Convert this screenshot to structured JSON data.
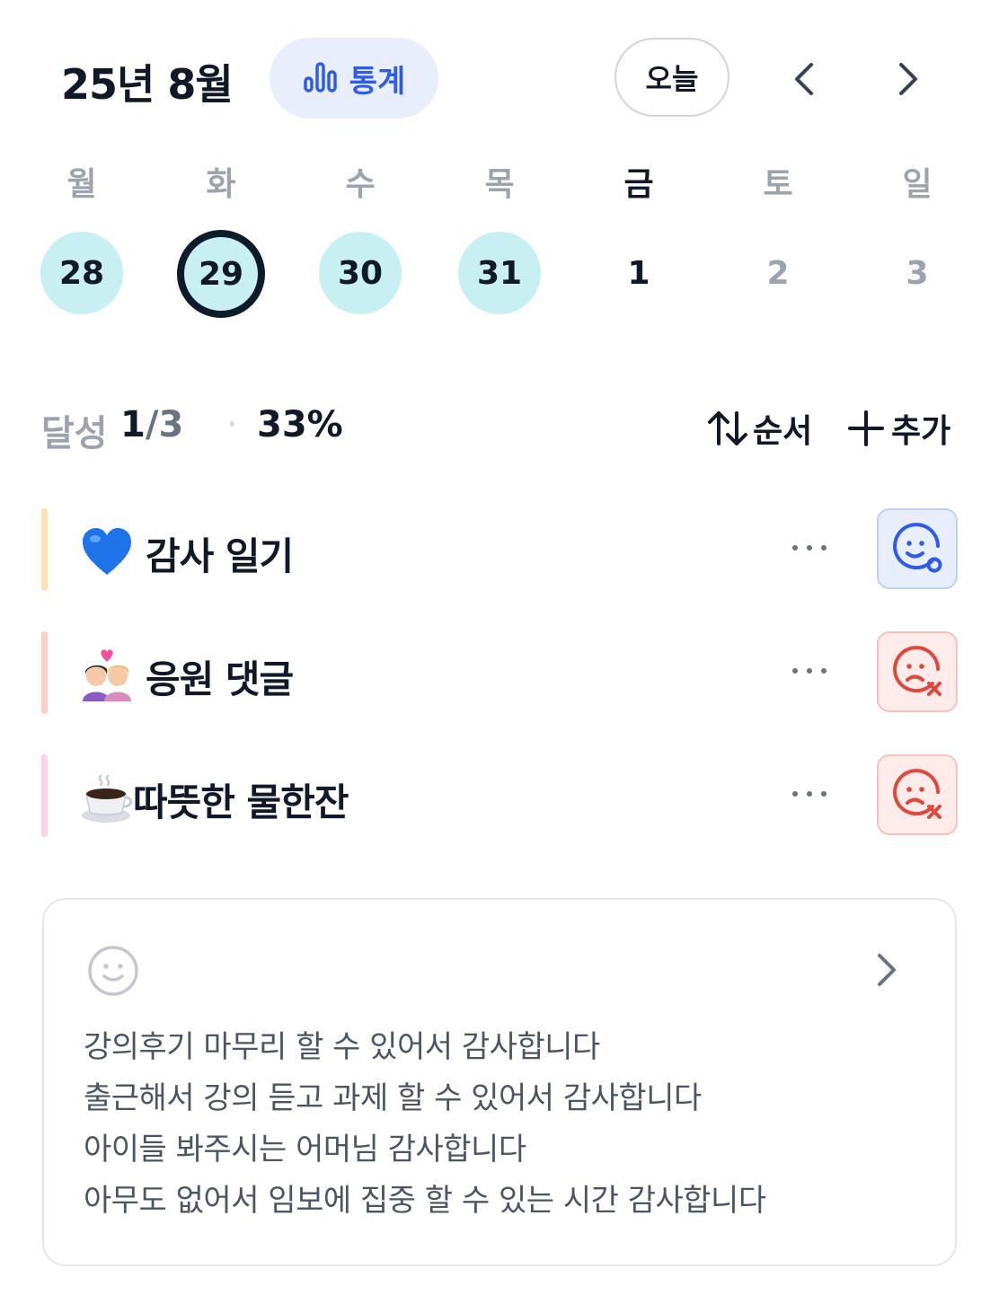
{
  "header": {
    "month_title": "25년 8월",
    "stats_label": "통계",
    "today_label": "오늘",
    "prev_icon": "chevron-left-icon",
    "next_icon": "chevron-right-icon",
    "accent_color": "#2f5bea"
  },
  "week": {
    "weekdays": [
      "월",
      "화",
      "수",
      "목",
      "금",
      "토",
      "일"
    ],
    "active_weekday_index": 4,
    "dates": [
      "28",
      "29",
      "30",
      "31",
      "1",
      "2",
      "3"
    ],
    "done_color": "#c8f0f2"
  },
  "summary": {
    "label": "달성",
    "done": "1",
    "total_part": "/3",
    "separator": "·",
    "percent": "33%",
    "order_label": "순서",
    "add_label": "추가"
  },
  "habits": [
    {
      "emoji": "blue-heart",
      "name": "감사 일기",
      "status": "done",
      "bar_color": "#fbe3b8"
    },
    {
      "emoji": "two-women-heart",
      "name": "응원 댓글",
      "status": "failed",
      "bar_color": "#fbd0c8"
    },
    {
      "emoji": "hot-beverage",
      "name": "따뜻한 물한잔",
      "status": "failed",
      "bar_color": "#fbd3e6"
    }
  ],
  "note": {
    "icon": "smile-face-icon",
    "lines": [
      "강의후기 마무리 할 수 있어서 감사합니다",
      "출근해서 강의 듣고 과제 할 수 있어서 감사합니다",
      "아이들 봐주시는 어머님 감사합니다",
      "아무도 없어서 임보에 집중 할 수 있는 시간 감사합니다"
    ]
  }
}
